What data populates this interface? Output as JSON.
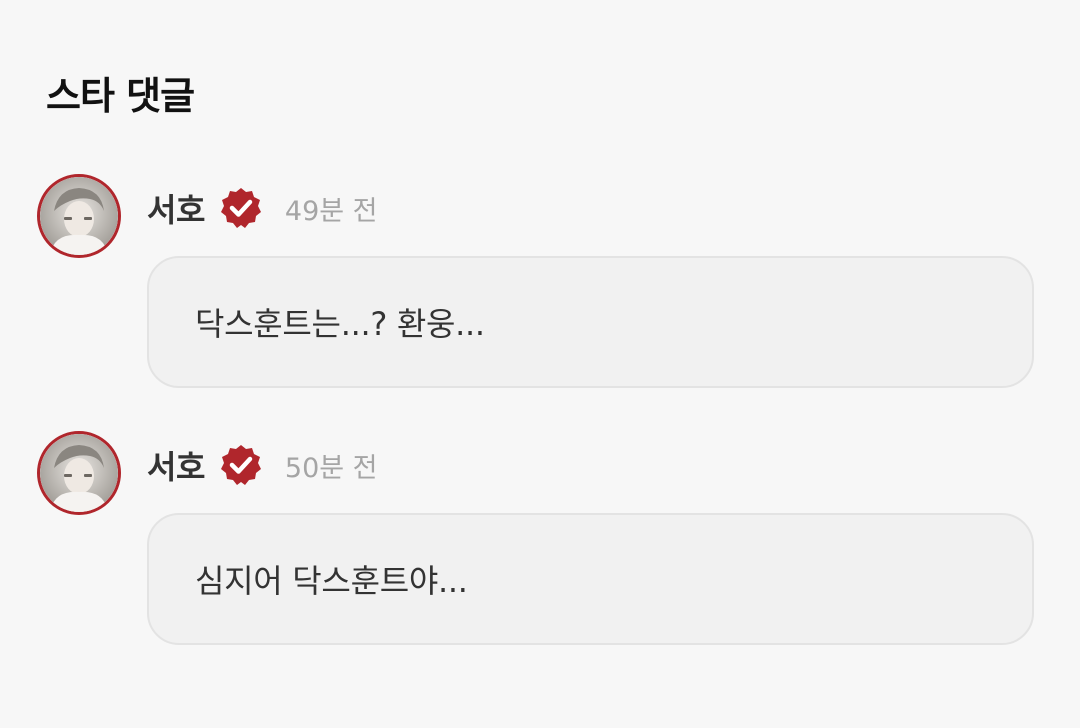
{
  "section": {
    "title": "스타 댓글"
  },
  "comments": [
    {
      "author": "서호",
      "verified_icon": "verified-badge",
      "time": "49분 전",
      "text": "닥스훈트는...? 환웅..."
    },
    {
      "author": "서호",
      "verified_icon": "verified-badge",
      "time": "50분 전",
      "text": "심지어 닥스훈트야..."
    }
  ],
  "colors": {
    "accent": "#b0262c",
    "background": "#f7f7f7",
    "bubble": "#f1f1f1",
    "timestamp": "#a5a5a5"
  }
}
